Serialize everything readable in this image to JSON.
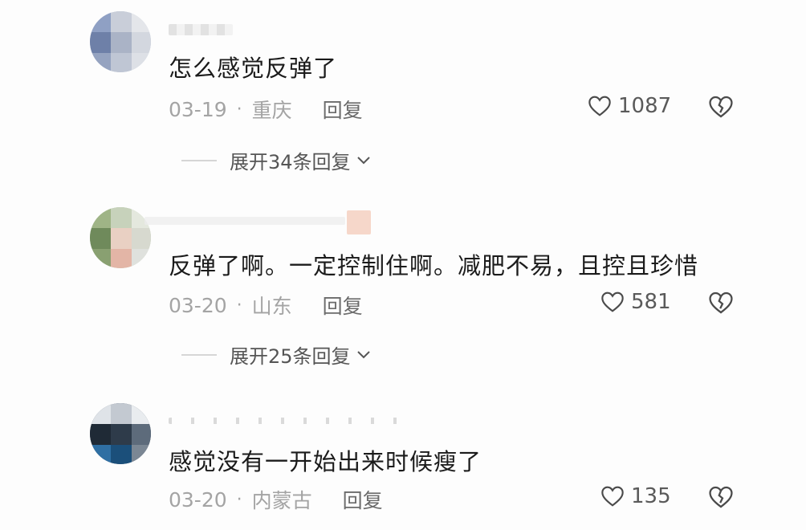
{
  "comments": [
    {
      "text": "怎么感觉反弹了",
      "date": "03-19",
      "location": "重庆",
      "reply_label": "回复",
      "likes": "1087",
      "expand_label": "展开34条回复"
    },
    {
      "text": "反弹了啊。一定控制住啊。减肥不易，且控且珍惜",
      "date": "03-20",
      "location": "山东",
      "reply_label": "回复",
      "likes": "581",
      "expand_label": "展开25条回复"
    },
    {
      "text": "感觉没有一开始出来时候瘦了",
      "date": "03-20",
      "location": "内蒙古",
      "reply_label": "回复",
      "likes": "135"
    }
  ],
  "icons": {
    "like": "heart-outline-icon",
    "dislike": "broken-heart-icon",
    "expand": "chevron-down-icon"
  },
  "colors": {
    "text": "#1b1b1b",
    "meta": "#a4a4a4",
    "reply": "#6b6b6b"
  }
}
